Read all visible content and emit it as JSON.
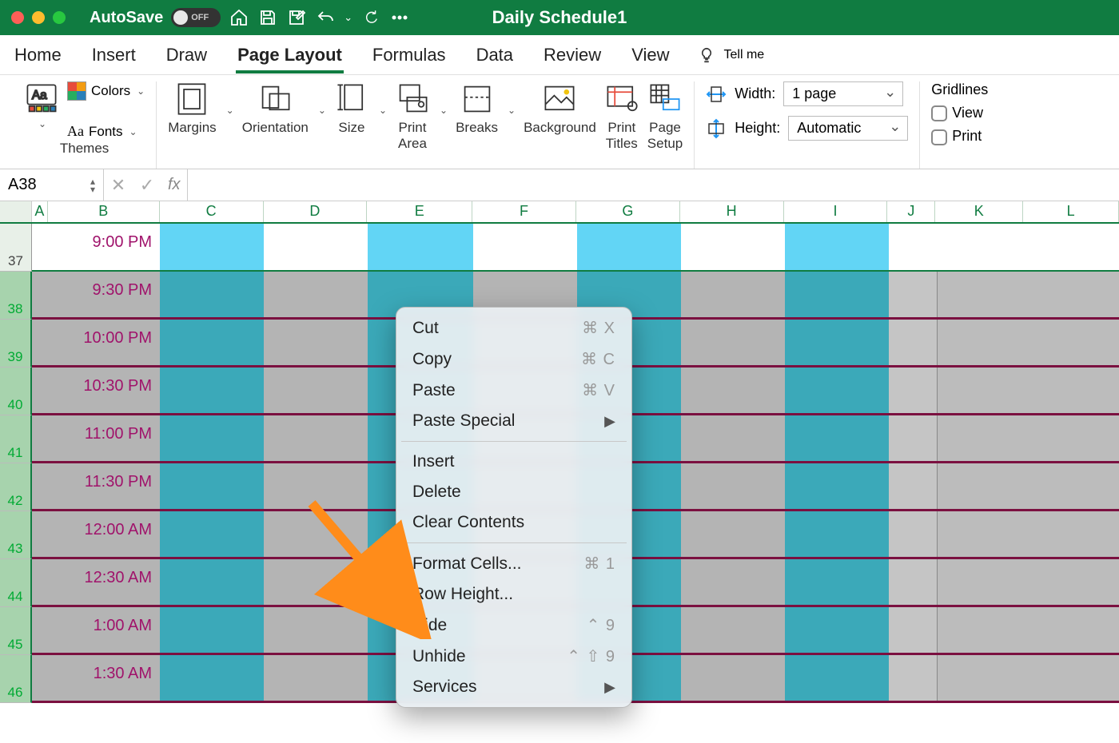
{
  "titlebar": {
    "autosave_label": "AutoSave",
    "toggle_state": "OFF",
    "doc_title": "Daily Schedule1"
  },
  "tabs": {
    "items": [
      "Home",
      "Insert",
      "Draw",
      "Page Layout",
      "Formulas",
      "Data",
      "Review",
      "View"
    ],
    "active_index": 3,
    "tellme": "Tell me"
  },
  "ribbon": {
    "themes_label": "Themes",
    "colors_label": "Colors",
    "fonts_label": "Fonts",
    "margins": "Margins",
    "orientation": "Orientation",
    "size": "Size",
    "print_area": "Print\nArea",
    "breaks": "Breaks",
    "background": "Background",
    "print_titles": "Print\nTitles",
    "page_setup": "Page\nSetup",
    "width_label": "Width:",
    "width_value": "1 page",
    "height_label": "Height:",
    "height_value": "Automatic",
    "gridlines_label": "Gridlines",
    "gridlines_view": "View",
    "gridlines_print": "Print"
  },
  "formula_bar": {
    "name_box": "A38",
    "fx_label": "fx",
    "value": ""
  },
  "columns": [
    "A",
    "B",
    "C",
    "D",
    "E",
    "F",
    "G",
    "H",
    "I",
    "J",
    "K",
    "L"
  ],
  "rows": [
    {
      "num": 37,
      "time": "9:00 PM",
      "selected": false
    },
    {
      "num": 38,
      "time": "9:30 PM",
      "selected": true
    },
    {
      "num": 39,
      "time": "10:00 PM",
      "selected": true
    },
    {
      "num": 40,
      "time": "10:30 PM",
      "selected": true
    },
    {
      "num": 41,
      "time": "11:00 PM",
      "selected": true
    },
    {
      "num": 42,
      "time": "11:30 PM",
      "selected": true
    },
    {
      "num": 43,
      "time": "12:00 AM",
      "selected": true
    },
    {
      "num": 44,
      "time": "12:30 AM",
      "selected": true
    },
    {
      "num": 45,
      "time": "1:00 AM",
      "selected": true
    },
    {
      "num": 46,
      "time": "1:30 AM",
      "selected": true
    }
  ],
  "context_menu": {
    "items": [
      {
        "label": "Cut",
        "shortcut": "⌘ X"
      },
      {
        "label": "Copy",
        "shortcut": "⌘ C"
      },
      {
        "label": "Paste",
        "shortcut": "⌘ V"
      },
      {
        "label": "Paste Special",
        "submenu": true
      },
      {
        "sep": true
      },
      {
        "label": "Insert"
      },
      {
        "label": "Delete"
      },
      {
        "label": "Clear Contents"
      },
      {
        "sep": true
      },
      {
        "label": "Format Cells...",
        "shortcut": "⌘ 1"
      },
      {
        "label": "Row Height..."
      },
      {
        "label": "Hide",
        "shortcut": "⌃ 9"
      },
      {
        "label": "Unhide",
        "shortcut": "⌃ ⇧ 9"
      },
      {
        "label": "Services",
        "submenu": true
      }
    ]
  }
}
